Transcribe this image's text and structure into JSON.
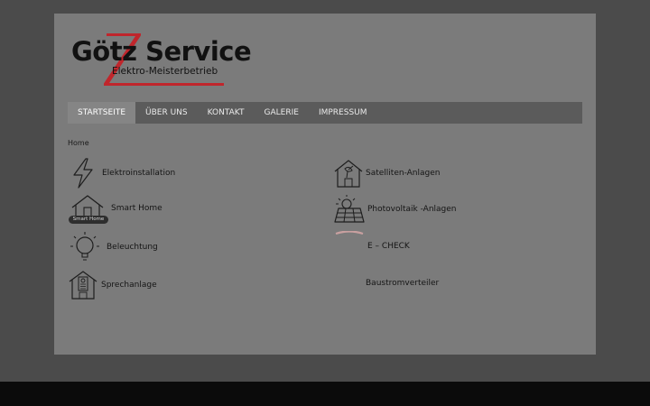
{
  "logo": {
    "title": "Götz Service",
    "subtitle": "Elektro-Meisterbetrieb"
  },
  "nav": [
    {
      "label": "STARTSEITE",
      "active": true
    },
    {
      "label": "ÜBER UNS"
    },
    {
      "label": "KONTAKT"
    },
    {
      "label": "GALERIE"
    },
    {
      "label": "IMPRESSUM"
    }
  ],
  "breadcrumb": "Home",
  "services": {
    "elektro": {
      "label": "Elektroinstallation",
      "icon": "lightning-icon"
    },
    "smarthome": {
      "label": "Smart Home",
      "icon": "smart-home-icon",
      "badge": "Smart Home"
    },
    "beleuchtung": {
      "label": "Beleuchtung",
      "icon": "light-bulb-icon"
    },
    "sprech": {
      "label": "Sprechanlage",
      "icon": "intercom-icon"
    },
    "satellit": {
      "label": "Satelliten-Anlagen",
      "icon": "satellite-house-icon"
    },
    "photovoltaik": {
      "label": "Photovoltaik -Anlagen",
      "icon": "solar-panel-icon"
    },
    "echeck": {
      "label": "E – CHECK",
      "icon": "e-check-icon"
    },
    "baustrom": {
      "label": "Baustromverteiler"
    }
  },
  "colors": {
    "background": "#4b4b4b",
    "page": "#7b7b7b",
    "nav": "#5b5b5b",
    "nav_active": "#858585",
    "logo_accent": "#c0262c"
  }
}
